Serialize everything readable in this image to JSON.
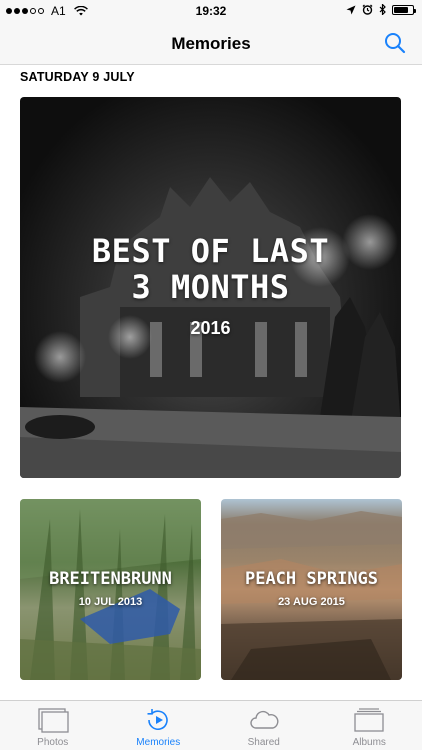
{
  "status_bar": {
    "carrier": "A1",
    "time": "19:32",
    "signal_bars_filled": 3,
    "signal_bars_total": 5,
    "battery_level": 0.8
  },
  "nav": {
    "title": "Memories",
    "search_icon": "search-icon"
  },
  "section": {
    "date": "SATURDAY 9 JULY"
  },
  "memories": {
    "featured": {
      "title_line1": "BEST OF LAST",
      "title_line2": "3 MONTHS",
      "year": "2016"
    },
    "items": [
      {
        "title": "BREITENBRUNN",
        "date": "10 JUL 2013"
      },
      {
        "title": "PEACH SPRINGS",
        "date": "23 AUG 2015"
      }
    ]
  },
  "tab_bar": {
    "tabs": [
      {
        "label": "Photos",
        "icon": "photos-icon",
        "active": false
      },
      {
        "label": "Memories",
        "icon": "memories-icon",
        "active": true
      },
      {
        "label": "Shared",
        "icon": "cloud-icon",
        "active": false
      },
      {
        "label": "Albums",
        "icon": "albums-icon",
        "active": false
      }
    ]
  },
  "colors": {
    "accent": "#1a82fb",
    "inactive": "#8e8e93",
    "bar_background": "#f7f7f7"
  }
}
